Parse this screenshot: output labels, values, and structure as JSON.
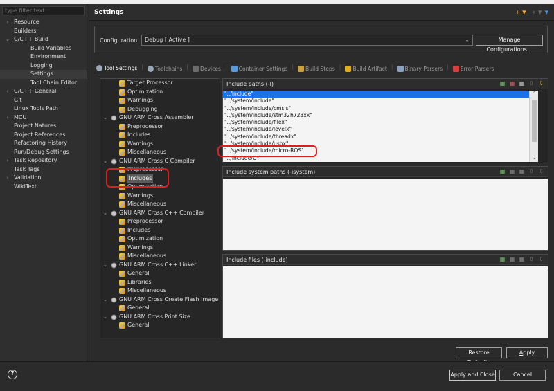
{
  "filter": {
    "placeholder": "type filter text"
  },
  "nav": {
    "items": [
      {
        "label": "Resource",
        "twisty": ">",
        "indent": 0
      },
      {
        "label": "Builders",
        "twisty": "",
        "indent": 0
      },
      {
        "label": "C/C++ Build",
        "twisty": "v",
        "indent": 0
      },
      {
        "label": "Build Variables",
        "twisty": "",
        "indent": 1
      },
      {
        "label": "Environment",
        "twisty": "",
        "indent": 1
      },
      {
        "label": "Logging",
        "twisty": "",
        "indent": 1
      },
      {
        "label": "Settings",
        "twisty": "",
        "indent": 1,
        "selected": true
      },
      {
        "label": "Tool Chain Editor",
        "twisty": "",
        "indent": 1
      },
      {
        "label": "C/C++ General",
        "twisty": ">",
        "indent": 0
      },
      {
        "label": "Git",
        "twisty": "",
        "indent": 0
      },
      {
        "label": "Linux Tools Path",
        "twisty": "",
        "indent": 0
      },
      {
        "label": "MCU",
        "twisty": ">",
        "indent": 0
      },
      {
        "label": "Project Natures",
        "twisty": "",
        "indent": 0
      },
      {
        "label": "Project References",
        "twisty": "",
        "indent": 0
      },
      {
        "label": "Refactoring History",
        "twisty": "",
        "indent": 0
      },
      {
        "label": "Run/Debug Settings",
        "twisty": "",
        "indent": 0
      },
      {
        "label": "Task Repository",
        "twisty": ">",
        "indent": 0
      },
      {
        "label": "Task Tags",
        "twisty": "",
        "indent": 0
      },
      {
        "label": "Validation",
        "twisty": ">",
        "indent": 0
      },
      {
        "label": "WikiText",
        "twisty": "",
        "indent": 0
      }
    ]
  },
  "header": {
    "title": "Settings"
  },
  "config": {
    "label": "Configuration:",
    "value": "Debug  [ Active ]",
    "manage_button": "Manage Configurations..."
  },
  "tabs": [
    {
      "label": "Tool Settings",
      "active": true,
      "icon": "gear-icon",
      "color": "#9aa8b8"
    },
    {
      "label": "Toolchains",
      "active": false,
      "icon": "gear-icon",
      "color": "#9aa8b8"
    },
    {
      "label": "Devices",
      "active": false,
      "icon": "device-icon",
      "color": "#6a6a6a"
    },
    {
      "label": "Container Settings",
      "active": false,
      "icon": "container-icon",
      "color": "#5a9ad8"
    },
    {
      "label": "Build Steps",
      "active": false,
      "icon": "wrench-icon",
      "color": "#c8a040"
    },
    {
      "label": "Build Artifact",
      "active": false,
      "icon": "trophy-icon",
      "color": "#e0b020"
    },
    {
      "label": "Binary Parsers",
      "active": false,
      "icon": "binary-icon",
      "color": "#8aa0c0"
    },
    {
      "label": "Error Parsers",
      "active": false,
      "icon": "error-icon",
      "color": "#d84040"
    }
  ],
  "tool_tree": [
    {
      "label": "Target Processor",
      "level": 1,
      "icon": "tool"
    },
    {
      "label": "Optimization",
      "level": 1,
      "icon": "tool"
    },
    {
      "label": "Warnings",
      "level": 1,
      "icon": "tool"
    },
    {
      "label": "Debugging",
      "level": 1,
      "icon": "tool"
    },
    {
      "label": "GNU ARM Cross Assembler",
      "level": 0,
      "icon": "gear"
    },
    {
      "label": "Preprocessor",
      "level": 1,
      "icon": "tool"
    },
    {
      "label": "Includes",
      "level": 1,
      "icon": "tool"
    },
    {
      "label": "Warnings",
      "level": 1,
      "icon": "tool"
    },
    {
      "label": "Miscellaneous",
      "level": 1,
      "icon": "tool"
    },
    {
      "label": "GNU ARM Cross C Compiler",
      "level": 0,
      "icon": "gear"
    },
    {
      "label": "Preprocessor",
      "level": 1,
      "icon": "tool"
    },
    {
      "label": "Includes",
      "level": 1,
      "icon": "tool",
      "selected": true
    },
    {
      "label": "Optimization",
      "level": 1,
      "icon": "tool"
    },
    {
      "label": "Warnings",
      "level": 1,
      "icon": "tool"
    },
    {
      "label": "Miscellaneous",
      "level": 1,
      "icon": "tool"
    },
    {
      "label": "GNU ARM Cross C++ Compiler",
      "level": 0,
      "icon": "gear"
    },
    {
      "label": "Preprocessor",
      "level": 1,
      "icon": "tool"
    },
    {
      "label": "Includes",
      "level": 1,
      "icon": "tool"
    },
    {
      "label": "Optimization",
      "level": 1,
      "icon": "tool"
    },
    {
      "label": "Warnings",
      "level": 1,
      "icon": "tool"
    },
    {
      "label": "Miscellaneous",
      "level": 1,
      "icon": "tool"
    },
    {
      "label": "GNU ARM Cross C++ Linker",
      "level": 0,
      "icon": "gear"
    },
    {
      "label": "General",
      "level": 1,
      "icon": "tool"
    },
    {
      "label": "Libraries",
      "level": 1,
      "icon": "tool"
    },
    {
      "label": "Miscellaneous",
      "level": 1,
      "icon": "tool"
    },
    {
      "label": "GNU ARM Cross Create Flash Image",
      "level": 0,
      "icon": "gear"
    },
    {
      "label": "General",
      "level": 1,
      "icon": "tool"
    },
    {
      "label": "GNU ARM Cross Print Size",
      "level": 0,
      "icon": "gear"
    },
    {
      "label": "General",
      "level": 1,
      "icon": "tool"
    }
  ],
  "include_paths": {
    "title": "Include paths (-I)",
    "items": [
      "\"../include\"",
      "\"../system/include\"",
      "\"../system/include/cmsis\"",
      "\"../system/include/stm32h723xx\"",
      "\"../system/include/filex\"",
      "\"../system/include/levelx\"",
      "\"../system/include/threadx\"",
      "\"../system/include/usbx\"",
      "\"../system/include/micro-ROS\"",
      "\"../include/CY\""
    ]
  },
  "include_system_paths": {
    "title": "Include system paths (-isystem)"
  },
  "include_files": {
    "title": "Include files (-include)"
  },
  "buttons": {
    "restore_pre": "Restore ",
    "restore_ul": "D",
    "restore_post": "efaults",
    "apply_ul": "A",
    "apply_post": "pply",
    "apply_close": "Apply and Close",
    "cancel": "Cancel"
  },
  "help": {
    "glyph": "?"
  }
}
